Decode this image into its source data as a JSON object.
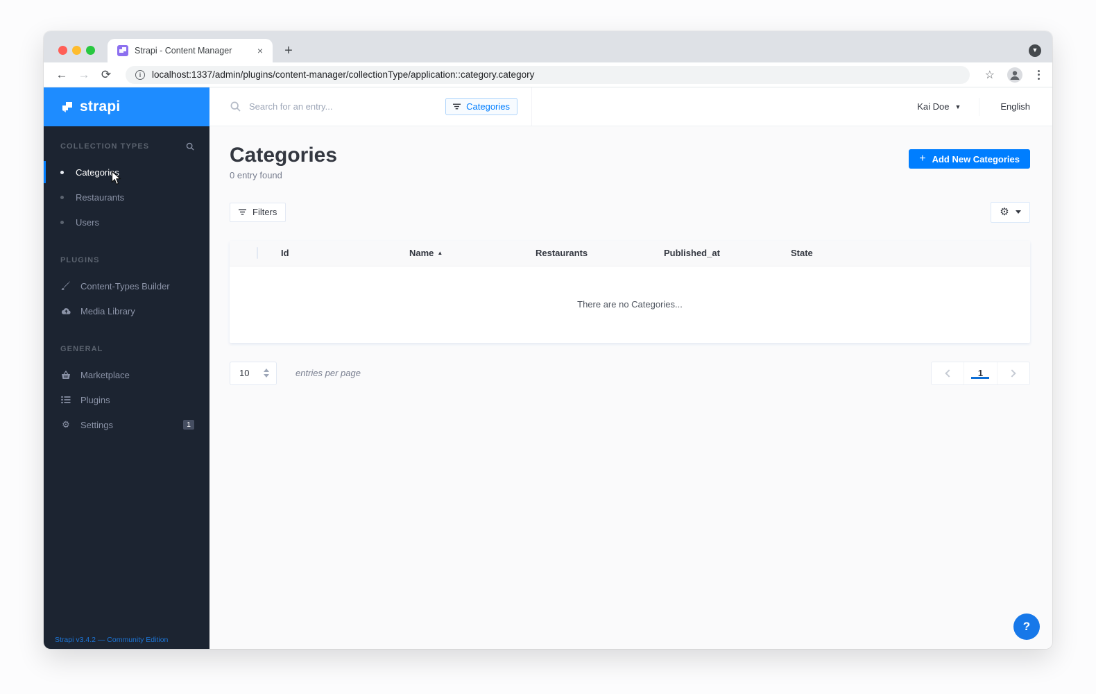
{
  "browser": {
    "tab_title": "Strapi - Content Manager",
    "url": "localhost:1337/admin/plugins/content-manager/collectionType/application::category.category",
    "new_tab_label": "+",
    "close_tab_label": "×"
  },
  "topbar": {
    "search_placeholder": "Search for an entry...",
    "filter_chip_label": "Categories",
    "user_name": "Kai Doe",
    "language_label": "English"
  },
  "sidebar": {
    "logo_text": "strapi",
    "sections": [
      {
        "label": "COLLECTION TYPES",
        "items": [
          {
            "label": "Categories",
            "active": true
          },
          {
            "label": "Restaurants"
          },
          {
            "label": "Users"
          }
        ]
      },
      {
        "label": "PLUGINS",
        "items": [
          {
            "label": "Content-Types Builder"
          },
          {
            "label": "Media Library"
          }
        ]
      },
      {
        "label": "GENERAL",
        "items": [
          {
            "label": "Marketplace"
          },
          {
            "label": "Plugins"
          },
          {
            "label": "Settings",
            "badge": "1"
          }
        ]
      }
    ],
    "footer": "Strapi v3.4.2 — Community Edition"
  },
  "main": {
    "title": "Categories",
    "subtitle": "0 entry found",
    "add_button_label": "Add New Categories",
    "filters_button_label": "Filters",
    "table": {
      "columns": [
        "Id",
        "Name",
        "Restaurants",
        "Published_at",
        "State"
      ],
      "sorted_column": "Name",
      "sort_direction": "asc",
      "rows": [],
      "empty_message": "There are no Categories..."
    },
    "pagination": {
      "per_page": "10",
      "per_page_label": "entries per page",
      "current_page": "1"
    }
  },
  "help_button_label": "?",
  "colors": {
    "accent_blue": "#007eff",
    "logo_blue": "#1e8cff",
    "sidebar_bg": "#1c2431",
    "content_bg": "#fafafb",
    "border": "#e3e9f3",
    "text_dark": "#333740",
    "text_gray": "#787e8f"
  }
}
